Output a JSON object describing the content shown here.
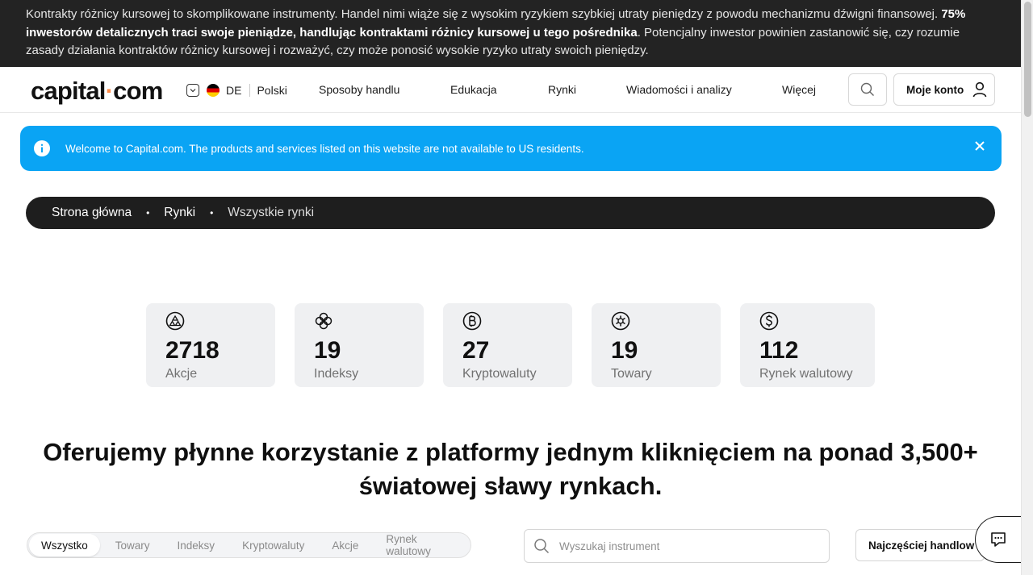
{
  "risk_banner": {
    "text_before": "Kontrakty różnicy kursowej to skomplikowane instrumenty. Handel nimi wiąże się z wysokim ryzykiem szybkiej utraty pieniędzy z powodu mechanizmu dźwigni finansowej. ",
    "text_bold": "75% inwestorów detalicznych traci swoje pieniądze, handlując kontraktami różnicy kursowej u tego pośrednika",
    "text_after": ". Potencjalny inwestor powinien zastanowić się, czy rozumie zasady działania kontraktów różnicy kursowej i rozważyć, czy może ponosić wysokie ryzyko utraty swoich pieniędzy."
  },
  "header": {
    "logo_left": "capital",
    "logo_dot": "·",
    "logo_right": "com",
    "region_code": "DE",
    "language": "Polski",
    "nav": [
      "Sposoby handlu",
      "Edukacja",
      "Rynki",
      "Wiadomości i analizy",
      "Więcej"
    ],
    "account_label": "Moje konto"
  },
  "info_banner": {
    "text": "Welcome to Capital.com. The products and services listed on this website are not available to US residents."
  },
  "breadcrumb": {
    "items": [
      "Strona główna",
      "Rynki",
      "Wszystkie rynki"
    ],
    "separator": "•"
  },
  "market_cards": [
    {
      "icon": "shares-icon",
      "count": "2718",
      "label": "Akcje"
    },
    {
      "icon": "indices-icon",
      "count": "19",
      "label": "Indeksy"
    },
    {
      "icon": "crypto-icon",
      "count": "27",
      "label": "Kryptowaluty"
    },
    {
      "icon": "commodities-icon",
      "count": "19",
      "label": "Towary"
    },
    {
      "icon": "forex-icon",
      "count": "112",
      "label": "Rynek walutowy"
    }
  ],
  "headline": "Oferujemy płynne korzystanie z platformy jednym kliknięciem na ponad 3,500+ światowej sławy rynkach.",
  "filters": {
    "tabs": [
      "Wszystko",
      "Towary",
      "Indeksy",
      "Kryptowaluty",
      "Akcje",
      "Rynek walutowy"
    ],
    "active": "Wszystko"
  },
  "search": {
    "placeholder": "Wyszukaj instrument",
    "value": ""
  },
  "sort": {
    "label": "Najczęściej handlow"
  },
  "colors": {
    "risk_bg": "#232323",
    "info_bg": "#0aa4f4",
    "breadcrumb_bg": "#1e1e1e",
    "card_bg": "#eff0f2",
    "logo_accent": "#ff8d4a"
  }
}
